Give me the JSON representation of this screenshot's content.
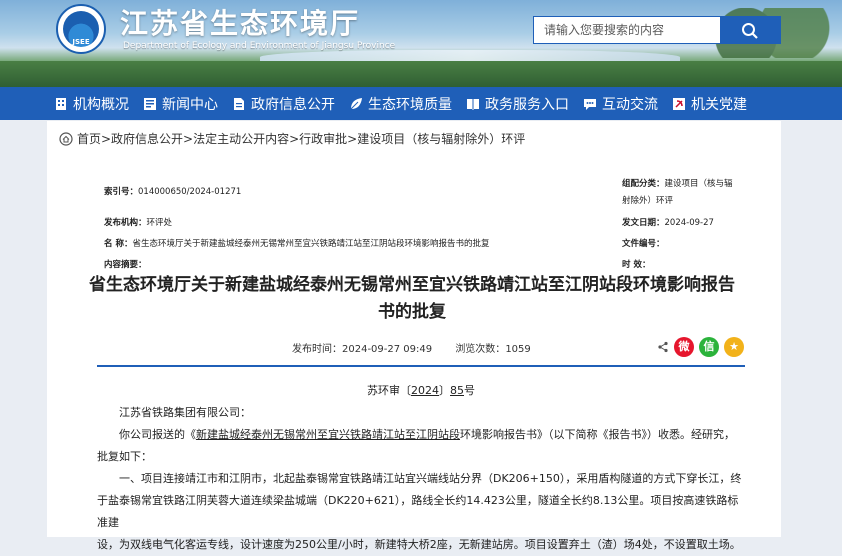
{
  "header": {
    "logo_text": "JSEE",
    "title": "江苏省生态环境厅",
    "subtitle": "Department of Ecology and Environment of Jiangsu Province",
    "search_placeholder": "请输入您要搜索的内容"
  },
  "nav": [
    {
      "label": "机构概况",
      "icon": "building-icon"
    },
    {
      "label": "新闻中心",
      "icon": "news-icon"
    },
    {
      "label": "政府信息公开",
      "icon": "document-icon"
    },
    {
      "label": "生态环境质量",
      "icon": "leaf-icon"
    },
    {
      "label": "政务服务入口",
      "icon": "book-icon"
    },
    {
      "label": "互动交流",
      "icon": "chat-icon"
    },
    {
      "label": "机关党建",
      "icon": "party-icon"
    }
  ],
  "breadcrumb": "首页>政府信息公开>法定主动公开内容>行政审批>建设项目（核与辐射除外）环评",
  "meta": {
    "index_label": "索引号：",
    "index_value": "014000650/2024-01271",
    "category_label": "组配分类：",
    "category_value_1": "建设项目（核与辐",
    "category_value_2": "射除外）环评",
    "publisher_label": "发布机构：",
    "publisher_value": "环评处",
    "date_label": "发文日期：",
    "date_value": "2024-09-27",
    "name_label": "名    称：",
    "name_value": "省生态环境厅关于新建盐城经泰州无锡常州至宜兴铁路靖江站至江阴站段环境影响报告书的批复",
    "docnum_label": "文件编号：",
    "docnum_value": "",
    "summary_label": "内容摘要：",
    "summary_value": "",
    "validity_label": "时    效：",
    "validity_value": ""
  },
  "article": {
    "title": "省生态环境厅关于新建盐城经泰州无锡常州至宜兴铁路靖江站至江阴站段环境影响报告书的批复",
    "publish_time_label": "发布时间：",
    "publish_time": "2024-09-27 09:49",
    "views_label": "浏览次数：",
    "views": "1059",
    "doc_no_prefix": "苏环审〔",
    "doc_no_year": "2024",
    "doc_no_mid": "〕",
    "doc_no_num": "85",
    "doc_no_suffix": "号",
    "salutation": "江苏省铁路集团有限公司：",
    "para1_prefix": "你公司报送的《",
    "para1_link": "新建盐城经泰州无锡常州至宜兴铁路靖江站至江阴站段",
    "para1_suffix": "环境影响报告书》（以下简称《报告书》）收悉。经研究，",
    "para1_line2": "批复如下：",
    "para2": "一、项目连接靖江市和江阴市，北起盐泰锡常宜铁路靖江站宜兴端线站分界（DK206+150），采用盾构隧道的方式下穿长江，终",
    "para2_line2": "于盐泰锡常宜铁路江阴芙蓉大道连续梁盐城端（DK220+621），路线全长约14.423公里，隧道全长约8.13公里。项目按高速铁路标准建",
    "para2_line3": "设，为双线电气化客运专线，设计速度为250公里/小时，新建特大桥2座，无新建站房。项目设置弃土（渣）场4处，不设置取土场。"
  },
  "colors": {
    "brand_blue": "#1f5fb8",
    "weibo_red": "#e6162d",
    "wechat_green": "#2bb33b",
    "qzone_yellow": "#f2b21a"
  }
}
